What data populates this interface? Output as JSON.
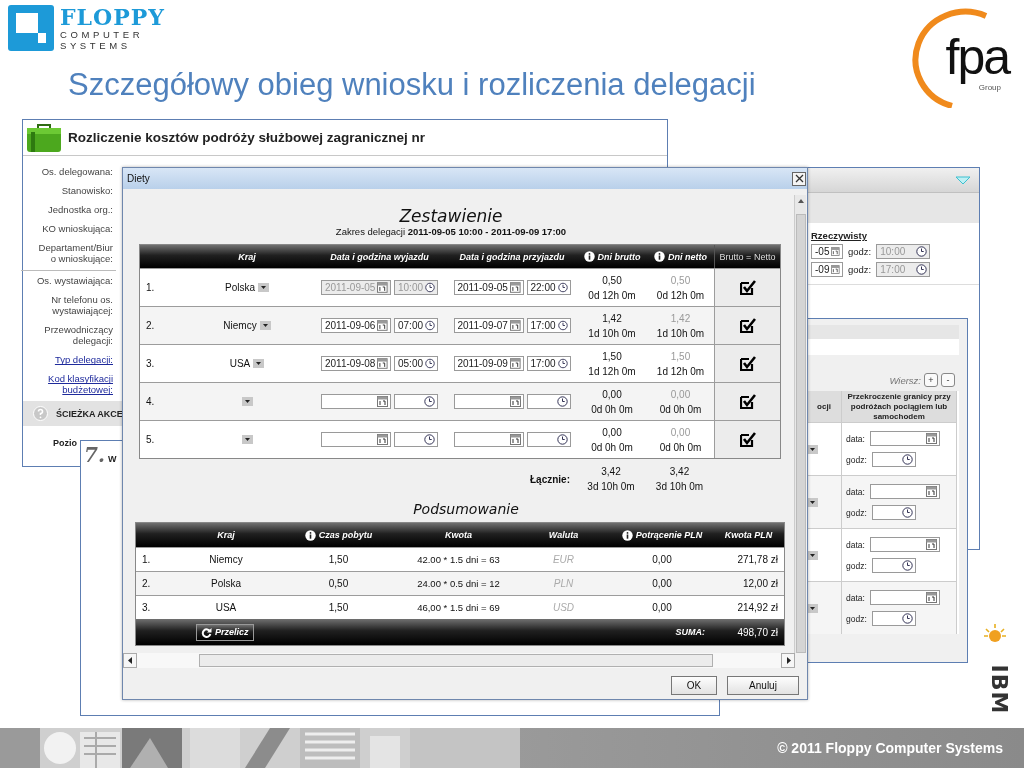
{
  "slide": {
    "title": "Szczegółowy obieg wniosku i rozliczenia delegacji",
    "footer": "© 2011 Floppy Computer Systems"
  },
  "logos": {
    "floppy": [
      "FLOPPY",
      "COMPUTER",
      "SYSTEMS"
    ],
    "fpa": {
      "mark": "fpa",
      "sub": "Group"
    },
    "ibm": "IBM"
  },
  "back_window": {
    "title": "Rozliczenie kosztów podróży służbowej zagranicznej nr",
    "field_groups": [
      [
        {
          "lines": [
            "Os. delegowana:"
          ],
          "kind": "label"
        },
        {
          "lines": [
            "Stanowisko:"
          ],
          "kind": "label"
        },
        {
          "lines": [
            "Jednostka org.:"
          ],
          "kind": "label"
        },
        {
          "lines": [
            "KO wnioskująca:"
          ],
          "kind": "label"
        },
        {
          "lines": [
            "Departament/Biur",
            "o wnioskujące:"
          ],
          "kind": "label"
        }
      ],
      [
        {
          "lines": [
            "Os. wystawiająca:"
          ],
          "kind": "label"
        },
        {
          "lines": [
            "Nr telefonu os.",
            "wystawiającej:"
          ],
          "kind": "label"
        },
        {
          "lines": [
            "Przewodniczący",
            "delegacji:"
          ],
          "kind": "label"
        },
        {
          "lines": [
            "Typ delegacji:"
          ],
          "kind": "link"
        },
        {
          "lines": [
            "Kod klasyfikacji",
            "budżetowej:"
          ],
          "kind": "link"
        }
      ]
    ],
    "section": "ŚCIEŻKA AKCE",
    "section_label": "Pozio"
  },
  "lower_window": {
    "number": "7.",
    "title": "W"
  },
  "right_window": {
    "heading": "Rzeczywisty",
    "rows": [
      {
        "date": "-05",
        "label": "godz:",
        "time": "10:00"
      },
      {
        "date": "-09",
        "label": "godz:",
        "time": "17:00"
      }
    ]
  },
  "side_panel": {
    "rows_label": "Wiersz:",
    "add": "+",
    "remove": "-",
    "columns": [
      "ocji",
      "Przekroczenie granicy przy podróżach pociągiem lub samochodem"
    ],
    "rows": [
      {
        "date_label": "data:",
        "time_label": "godz:"
      },
      {
        "date_label": "data:",
        "time_label": "godz:"
      },
      {
        "date_label": "data:",
        "time_label": "godz:"
      },
      {
        "date_label": "data:",
        "time_label": "godz:"
      }
    ]
  },
  "dialog": {
    "title": "Diety",
    "heading": "Zestawienie",
    "range_label": "Zakres delegacji",
    "range": "2011-09-05 10:00 - 2011-09-09 17:00",
    "columns": [
      {
        "label": "Kraj",
        "info": false
      },
      {
        "label": "Data i godzina wyjazdu",
        "info": false
      },
      {
        "label": "Data i godzina przyjazdu",
        "info": false
      },
      {
        "label": "Dni brutto",
        "info": true
      },
      {
        "label": "Dni netto",
        "info": true
      },
      {
        "label": "Brutto = Netto",
        "info": false
      }
    ],
    "rows": [
      {
        "no": "1.",
        "country": "Polska",
        "departure_disabled": true,
        "dep_date": "2011-09-05",
        "dep_time": "10:00",
        "arr_date": "2011-09-05",
        "arr_time": "22:00",
        "gross": "0,50",
        "gross_span": "0d 12h 0m",
        "net": "0,50",
        "net_span": "0d 12h 0m",
        "checked": true
      },
      {
        "no": "2.",
        "country": "Niemcy",
        "departure_disabled": false,
        "dep_date": "2011-09-06",
        "dep_time": "07:00",
        "arr_date": "2011-09-07",
        "arr_time": "17:00",
        "gross": "1,42",
        "gross_span": "1d 10h 0m",
        "net": "1,42",
        "net_span": "1d 10h 0m",
        "checked": true
      },
      {
        "no": "3.",
        "country": "USA",
        "departure_disabled": false,
        "dep_date": "2011-09-08",
        "dep_time": "05:00",
        "arr_date": "2011-09-09",
        "arr_time": "17:00",
        "gross": "1,50",
        "gross_span": "1d 12h 0m",
        "net": "1,50",
        "net_span": "1d 12h 0m",
        "checked": true
      },
      {
        "no": "4.",
        "departure_disabled": false,
        "gross": "0,00",
        "gross_span": "0d 0h 0m",
        "net": "0,00",
        "net_span": "0d 0h 0m",
        "checked": true
      },
      {
        "no": "5.",
        "departure_disabled": false,
        "gross": "0,00",
        "gross_span": "0d 0h 0m",
        "net": "0,00",
        "net_span": "0d 0h 0m",
        "checked": true
      }
    ],
    "total_label": "Łącznie:",
    "total_gross": "3,42",
    "total_gross_span": "3d 10h 0m",
    "total_net": "3,42",
    "total_net_span": "3d 10h 0m",
    "summary": {
      "title": "Podsumowanie",
      "columns": [
        {
          "label": "Kraj",
          "info": false
        },
        {
          "label": "Czas pobytu",
          "info": true
        },
        {
          "label": "Kwota",
          "info": false
        },
        {
          "label": "Waluta",
          "info": false
        },
        {
          "label": "Potrącenie PLN",
          "info": true
        },
        {
          "label": "Kwota PLN",
          "info": false
        }
      ],
      "rows": [
        {
          "no": "1.",
          "country": "Niemcy",
          "stay": "1,50",
          "amount": "42.00 * 1.5 dni = 63",
          "currency": "EUR",
          "deduction": "0,00",
          "total": "271,78 zł"
        },
        {
          "no": "2.",
          "country": "Polska",
          "stay": "0,50",
          "amount": "24.00 * 0.5 dni  = 12",
          "currency": "PLN",
          "deduction": "0,00",
          "total": "12,00 zł"
        },
        {
          "no": "3.",
          "country": "USA",
          "stay": "1,50",
          "amount": "46,00 * 1.5 dni  = 69",
          "currency": "USD",
          "deduction": "0,00",
          "total": "214,92 zł"
        }
      ],
      "recalc": "Przelicz",
      "sum_label": "SUMA:",
      "sum": "498,70 zł"
    },
    "buttons": [
      "OK",
      "Anuluj"
    ]
  }
}
